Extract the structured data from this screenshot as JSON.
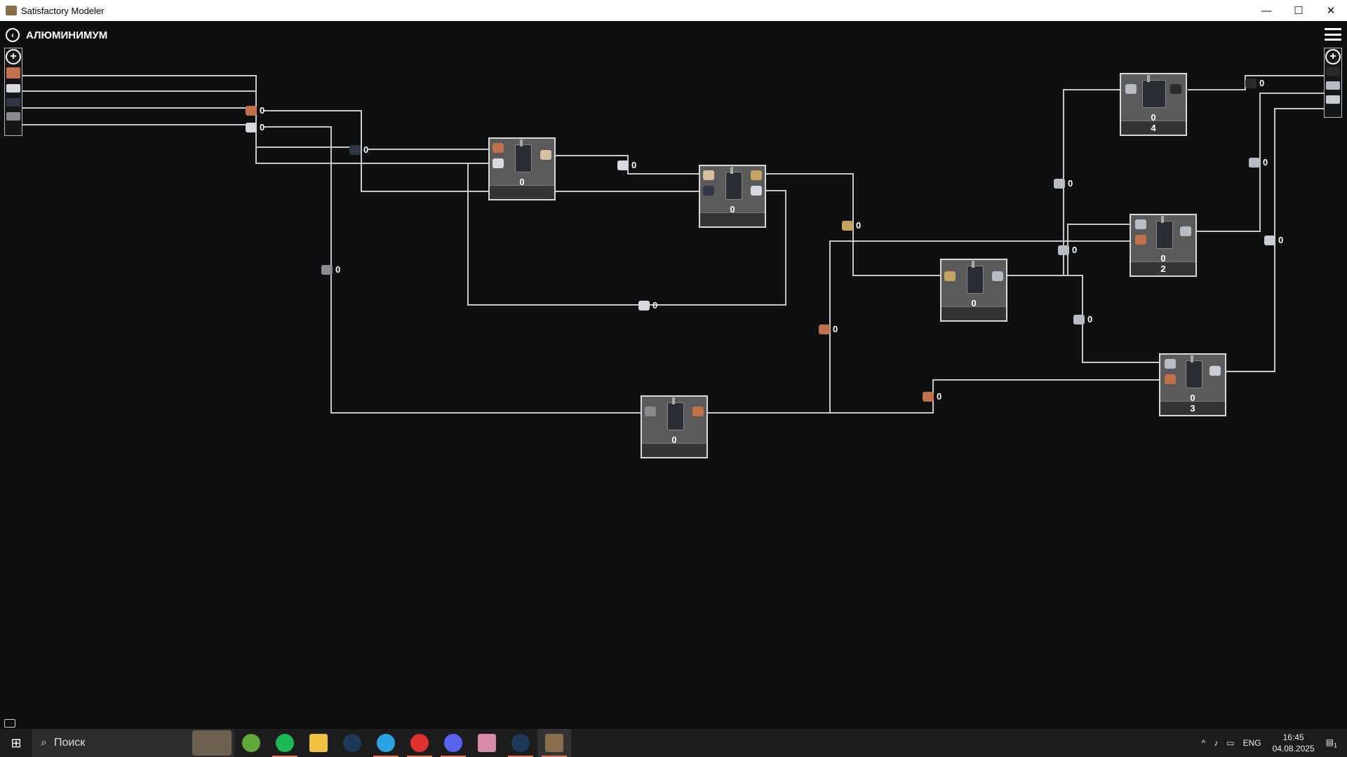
{
  "window": {
    "title": "Satisfactory Modeler",
    "minimize_glyph": "—",
    "maximize_glyph": "☐",
    "close_glyph": "✕"
  },
  "header": {
    "title": "АЛЮМИНИМУМ",
    "back_glyph": "‹"
  },
  "ports": {
    "left": {
      "add_glyph": "+",
      "items": [
        {
          "icon": "copper-ore-icon"
        },
        {
          "icon": "quartz-icon"
        },
        {
          "icon": "coal-icon"
        },
        {
          "icon": "bauxite-icon"
        }
      ]
    },
    "right": {
      "add_glyph": "+",
      "items": [
        {
          "icon": "dark-ingot-icon"
        },
        {
          "icon": "aluminum-sheet-icon"
        },
        {
          "icon": "aluminum-casing-icon"
        }
      ]
    }
  },
  "flows": [
    {
      "id": "copper-ore",
      "value": "0"
    },
    {
      "id": "quartz-left",
      "value": "0"
    },
    {
      "id": "coal",
      "value": "0"
    },
    {
      "id": "quartz-mid",
      "value": "0"
    },
    {
      "id": "bauxite",
      "value": "0"
    },
    {
      "id": "quartz-bottom",
      "value": "0"
    },
    {
      "id": "alumina",
      "value": "0"
    },
    {
      "id": "copper-powder",
      "value": "0"
    },
    {
      "id": "copper-low",
      "value": "0"
    },
    {
      "id": "aluminum-ingot-a",
      "value": "0"
    },
    {
      "id": "aluminum-ingot-b",
      "value": "0"
    },
    {
      "id": "aluminum-ingot-c",
      "value": "0"
    },
    {
      "id": "dark-out",
      "value": "0"
    },
    {
      "id": "sheet-out",
      "value": "0"
    },
    {
      "id": "casing-out",
      "value": "0"
    }
  ],
  "nodes": [
    {
      "id": "refinery-1",
      "value": "0",
      "count": ""
    },
    {
      "id": "refinery-2",
      "value": "0",
      "count": ""
    },
    {
      "id": "smelter",
      "value": "0",
      "count": ""
    },
    {
      "id": "constructor",
      "value": "0",
      "count": ""
    },
    {
      "id": "manufacturer",
      "value": "0",
      "count": "4"
    },
    {
      "id": "assembler-a",
      "value": "0",
      "count": "2"
    },
    {
      "id": "assembler-b",
      "value": "0",
      "count": "3"
    }
  ],
  "colors": {
    "copper": "#c0704a",
    "quartz": "#d8d8e0",
    "coal": "#303848",
    "bauxite": "#8a8a90",
    "alumina": "#c8a060",
    "ingot": "#b8bcc4",
    "dark": "#2a2a2a",
    "wire": "#c8c8c8"
  },
  "taskbar": {
    "search_placeholder": "Поиск",
    "lang": "ENG",
    "time": "16:45",
    "date": "04.08.2025",
    "notify_count": "1",
    "apps": [
      {
        "name": "utorrent-icon",
        "color": "#5fa83a"
      },
      {
        "name": "spotify-icon",
        "color": "#1db954"
      },
      {
        "name": "explorer-icon",
        "color": "#f0c040"
      },
      {
        "name": "steam-icon",
        "color": "#1b3a5c"
      },
      {
        "name": "telegram-icon",
        "color": "#2aa3e0"
      },
      {
        "name": "yandex-icon",
        "color": "#e03030"
      },
      {
        "name": "discord-icon",
        "color": "#5865f2"
      },
      {
        "name": "anime-app-icon",
        "color": "#d88aa8"
      },
      {
        "name": "steam-2-icon",
        "color": "#1b3a5c"
      },
      {
        "name": "satisfactory-modeler-icon",
        "color": "#8a6d4a"
      }
    ]
  }
}
